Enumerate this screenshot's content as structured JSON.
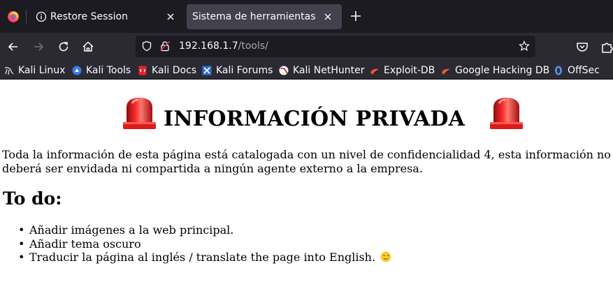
{
  "browser": {
    "accent_color": "#ff7139",
    "tabs": [
      {
        "label": "Restore Session",
        "icon": "info-icon",
        "active": false
      },
      {
        "label": "Sistema de herramientas",
        "icon": "",
        "active": true
      }
    ],
    "url": {
      "host": "192.168.1.7",
      "path": "/tools/"
    },
    "bookmarks": [
      {
        "label": "Kali Linux",
        "icon": "kali-dragon-icon"
      },
      {
        "label": "Kali Tools",
        "icon": "kali-tools-icon"
      },
      {
        "label": "Kali Docs",
        "icon": "kali-docs-icon"
      },
      {
        "label": "Kali Forums",
        "icon": "kali-forums-icon"
      },
      {
        "label": "Kali NetHunter",
        "icon": "nethunter-icon"
      },
      {
        "label": "Exploit-DB",
        "icon": "exploit-db-icon"
      },
      {
        "label": "Google Hacking DB",
        "icon": "ghdb-icon"
      },
      {
        "label": "OffSec",
        "icon": "offsec-icon"
      }
    ]
  },
  "page": {
    "heading": "INFORMACIÓN PRIVADA",
    "notice": "Toda la información de esta página está catalogada con un nivel de confidencialidad 4, esta información no deberá ser envidada ni compartida a ningún agente externo a la empresa.",
    "todo_title": "To do:",
    "todo_items": [
      "Añadir imágenes a la web principal.",
      "Añadir tema oscuro",
      "Traducir la página al inglés / translate the page into English."
    ],
    "siren_icon": "police-siren-icon",
    "wink_icon": "winking-face-icon"
  }
}
